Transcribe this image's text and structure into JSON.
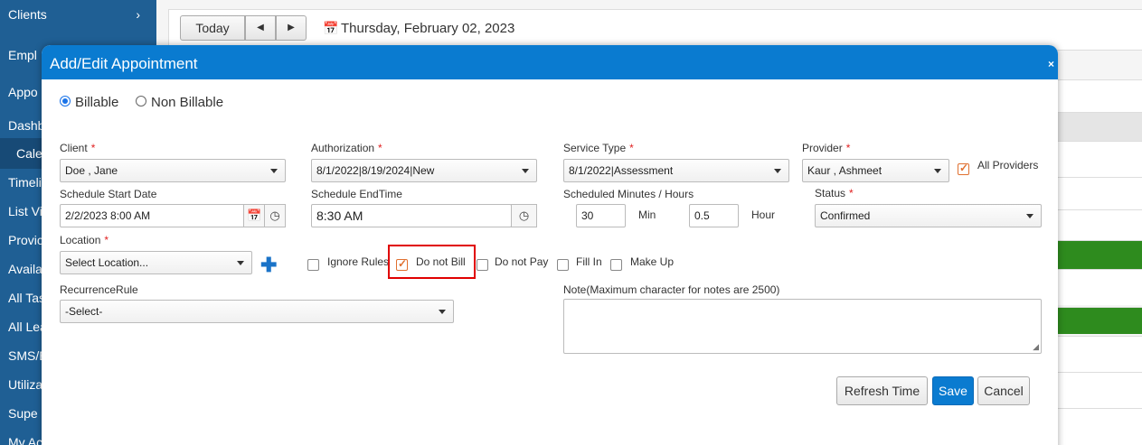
{
  "sidebar": {
    "items": [
      {
        "label": "Clients",
        "top": 0
      },
      {
        "label": "Empl",
        "top": 0
      },
      {
        "label": "Appo",
        "top": 0
      },
      {
        "label": "Dashb",
        "top": 0
      },
      {
        "label": "Cale",
        "top": 0
      },
      {
        "label": "Timeli",
        "top": 0
      },
      {
        "label": "List Vi",
        "top": 0
      },
      {
        "label": "Provic",
        "top": 0
      },
      {
        "label": "Availa",
        "top": 0
      },
      {
        "label": "All Tas",
        "top": 0
      },
      {
        "label": "All Lea",
        "top": 0
      },
      {
        "label": "SMS/E",
        "top": 0
      },
      {
        "label": "Utiliza",
        "top": 0
      },
      {
        "label": "Supe",
        "top": 0
      },
      {
        "label": "My Ac",
        "top": 0
      }
    ],
    "clients_chevron": "›"
  },
  "calendar": {
    "today_label": "Today",
    "prev_icon": "◀",
    "next_icon": "▶",
    "date_label": "Thursday, February 02, 2023"
  },
  "modal": {
    "title": "Add/Edit Appointment",
    "close_icon": "×",
    "billable_label": "Billable",
    "non_billable_label": "Non Billable",
    "client": {
      "label": "Client",
      "value": "Doe , Jane"
    },
    "authorization": {
      "label": "Authorization",
      "value": "8/1/2022|8/19/2024|New"
    },
    "service_type": {
      "label": "Service Type",
      "value": "8/1/2022|Assessment"
    },
    "provider": {
      "label": "Provider",
      "value": "Kaur , Ashmeet"
    },
    "all_providers_label": "All Providers",
    "schedule_start": {
      "label": "Schedule Start Date",
      "value": "2/2/2023 8:00 AM"
    },
    "schedule_end": {
      "label": "Schedule EndTime",
      "value": "8:30 AM"
    },
    "scheduled_minutes": {
      "label": "Scheduled Minutes / Hours",
      "minutes_value": "30",
      "min_label": "Min",
      "hours_value": "0.5",
      "hour_label": "Hour"
    },
    "status": {
      "label": "Status",
      "value": "Confirmed"
    },
    "location": {
      "label": "Location",
      "value": "Select Location..."
    },
    "ignore_rules_label": "Ignore Rules",
    "do_not_bill_label": "Do not Bill",
    "do_not_pay_label": "Do not Pay",
    "fill_in_label": "Fill In",
    "make_up_label": "Make Up",
    "recurrence": {
      "label": "RecurrenceRule",
      "value": "-Select-"
    },
    "note": {
      "label": "Note(Maximum character for notes are 2500)",
      "value": ""
    },
    "refresh_time_label": "Refresh Time",
    "save_label": "Save",
    "cancel_label": "Cancel",
    "required_mark": "*",
    "calendar_icon": "📅",
    "clock_icon": "◷",
    "plus_icon": "✚",
    "resize_icon": "◢"
  },
  "colors": {
    "sidebar_bg": "#1f5f94",
    "modal_header": "#0a7bd0",
    "primary_button": "#0a7bd0",
    "required": "#e02020",
    "highlight": "#e00000",
    "checked_box": "#e07030",
    "event_green": "#2e8b1e"
  }
}
